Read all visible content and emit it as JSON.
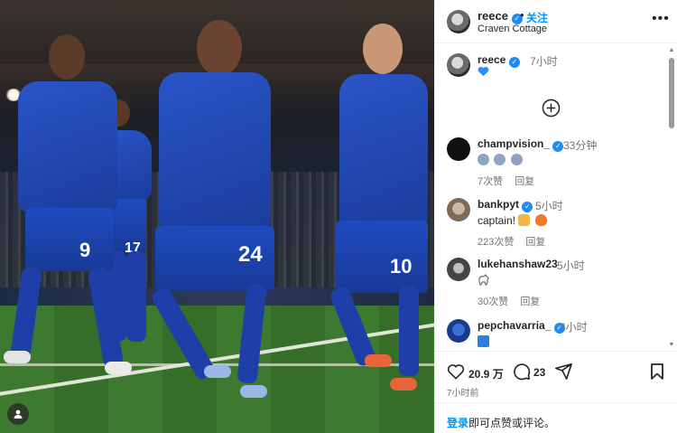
{
  "post_image": {
    "jersey_numbers": [
      "9",
      "24",
      "10"
    ],
    "accent_color": "#1e4bb8"
  },
  "header": {
    "username": "reece",
    "separator": "•",
    "follow_label": "关注",
    "location": "Craven Cottage",
    "more_icon": "more-horizontal-icon"
  },
  "caption": {
    "username": "reece",
    "time": "7小时",
    "text_emoji": "blue-heart"
  },
  "comments": [
    {
      "username": "champvision_",
      "verified": true,
      "time": "33分钟",
      "emojis": [
        "crying-face",
        "crying-face",
        "crying-face"
      ],
      "likes": "7次赞",
      "reply": "回复"
    },
    {
      "username": "bankpyt",
      "verified": true,
      "time": "5小时",
      "text": "captain!",
      "emojis": [
        "raising-hands",
        "fire"
      ],
      "likes": "223次赞",
      "reply": "回复"
    },
    {
      "username": "lukehanshaw23",
      "verified": false,
      "time": "5小时",
      "emojis": [
        "goat"
      ],
      "likes": "30次赞",
      "reply": "回复"
    },
    {
      "username": "pepchavarria_",
      "verified": true,
      "time": "6小时",
      "emojis": [
        "blue-square"
      ]
    }
  ],
  "actions": {
    "like_count": "20.9 万",
    "comment_count": "23",
    "posted_time": "7小时前"
  },
  "footer": {
    "login_label": "登录",
    "rest_text": "即可点赞或评论。"
  },
  "colors": {
    "link_blue": "#0095f6",
    "verified_blue": "#1e8cf0",
    "muted_text": "#737373"
  }
}
